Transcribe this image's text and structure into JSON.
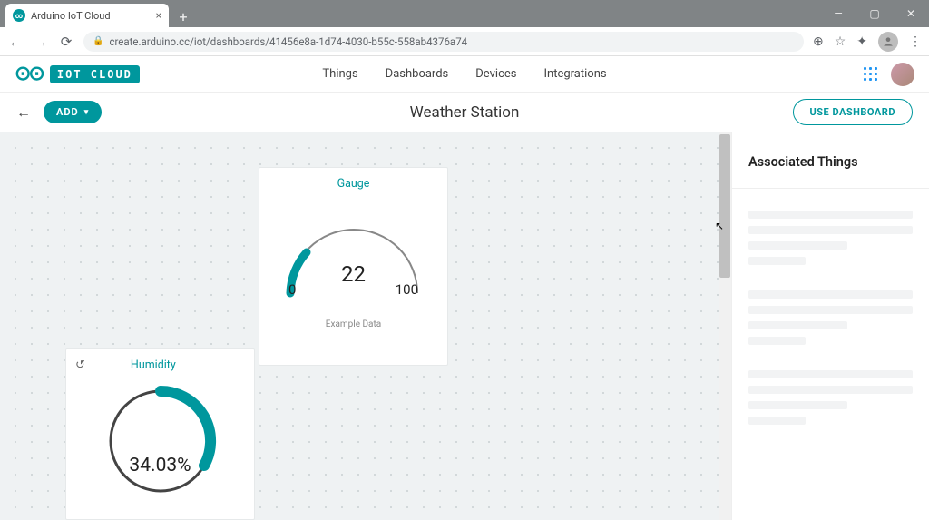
{
  "browser": {
    "tab_title": "Arduino IoT Cloud",
    "url": "create.arduino.cc/iot/dashboards/41456e8a-1d74-4030-b55c-558ab4376a74"
  },
  "header": {
    "logo_text": "IOT CLOUD",
    "nav": {
      "things": "Things",
      "dashboards": "Dashboards",
      "devices": "Devices",
      "integrations": "Integrations"
    }
  },
  "toolbar": {
    "add_label": "ADD",
    "dashboard_title": "Weather Station",
    "use_label": "USE DASHBOARD"
  },
  "widgets": {
    "gauge": {
      "title": "Gauge",
      "value": "22",
      "min": "0",
      "max": "100",
      "footer": "Example Data"
    },
    "humidity": {
      "title": "Humidity",
      "value": "34.03%"
    }
  },
  "side_panel": {
    "heading": "Associated Things"
  },
  "chart_data": [
    {
      "type": "gauge",
      "title": "Gauge",
      "value": 22,
      "min": 0,
      "max": 100,
      "unit": "",
      "note": "Example Data",
      "accent": "#00979d"
    },
    {
      "type": "gauge",
      "title": "Humidity",
      "value": 34.03,
      "min": 0,
      "max": 100,
      "unit": "%",
      "accent": "#00979d"
    }
  ]
}
